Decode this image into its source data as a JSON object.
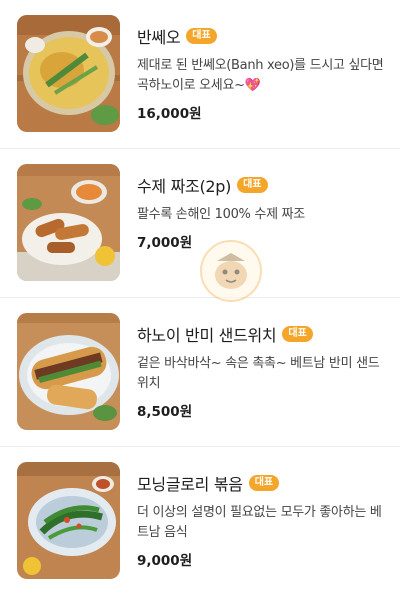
{
  "badge_label": "대표",
  "menu_items": [
    {
      "name": "반쎄오",
      "description": "제대로 된 반쎄오(Banh xeo)를 드시고 싶다면 곡하노이로 오세요~",
      "emoji": "💖",
      "price": "16,000원",
      "image_icon": "banh-xeo-photo"
    },
    {
      "name": "수제 짜조(2p)",
      "description": "팔수록 손해인 100% 수제 짜조",
      "emoji": "",
      "price": "7,000원",
      "image_icon": "spring-roll-photo"
    },
    {
      "name": "하노이 반미 샌드위치",
      "description": "겉은 바삭바삭~ 속은 촉촉~ 베트남 반미 샌드위치",
      "emoji": "",
      "price": "8,500원",
      "image_icon": "banh-mi-photo"
    },
    {
      "name": "모닝글로리 볶음",
      "description": "더 이상의 설명이 필요없는 모두가 좋아하는 베트남 음식",
      "emoji": "",
      "price": "9,000원",
      "image_icon": "morning-glory-photo"
    }
  ],
  "colors": {
    "badge": "#f4a62a",
    "heart": "#e0529a"
  }
}
